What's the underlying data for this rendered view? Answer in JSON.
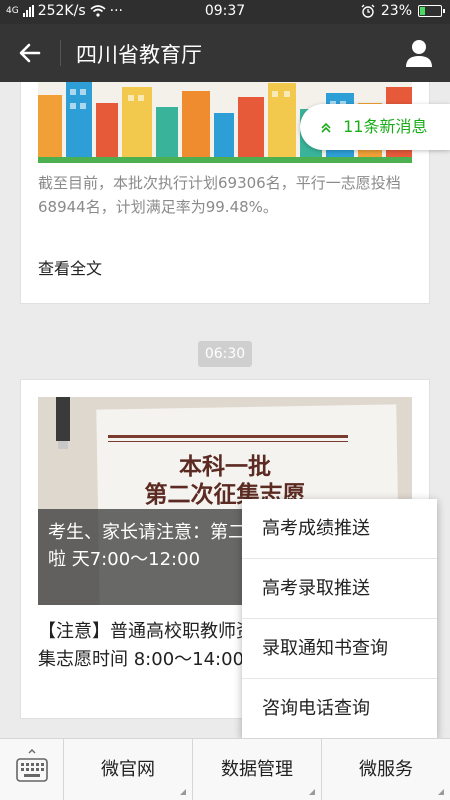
{
  "status_bar": {
    "signal": "4G",
    "speed": "252K/s",
    "dots": "···",
    "time": "09:37",
    "battery": "23%",
    "battery_level": 0.23
  },
  "title_bar": {
    "title": "四川省教育厅"
  },
  "new_messages": {
    "label": "11条新消息",
    "icon": "double-chevron-up-icon"
  },
  "articles": [
    {
      "summary": "截至目前，本批次执行计划69306名，平行一志愿投档68944名，计划满足率为99.48%。",
      "read_more": "查看全文"
    },
    {
      "banner_title_line1": "本科一批",
      "banner_title_line2": "第二次征集志愿",
      "overlay_text": "考生、家长请注意：第二次征集志愿通知来啦 天7:00～12:00",
      "text": "【注意】普通高校职教师资和部分口招生本科征集志愿时间 8:00～14:00"
    }
  ],
  "time_badge": "06:30",
  "popup_menu": {
    "items": [
      "高考成绩推送",
      "高考录取推送",
      "录取通知书查询",
      "咨询电话查询"
    ]
  },
  "bottom_menu": {
    "keyboard_icon": "keyboard-icon",
    "items": [
      "微官网",
      "数据管理",
      "微服务"
    ]
  },
  "colors": {
    "accent_green": "#1aad19",
    "title_bar": "#353535"
  }
}
